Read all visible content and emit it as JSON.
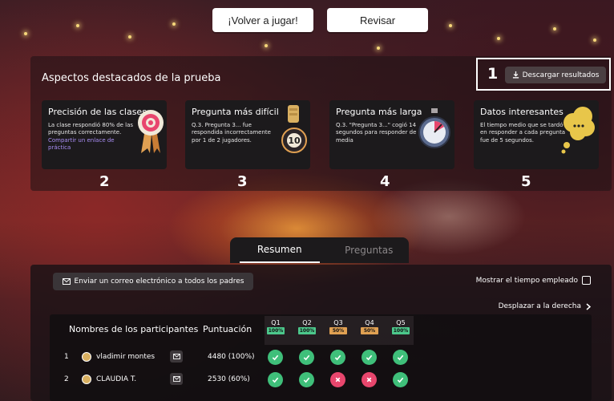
{
  "top_buttons": {
    "replay": "¡Volver a jugar!",
    "review": "Revisar"
  },
  "highlights": {
    "title": "Aspectos destacados de la prueba",
    "download_number": "1",
    "download_label": "Descargar resultados",
    "cards": [
      {
        "title": "Precisión de las clases",
        "description": "La clase respondió 80% de las preguntas correctamente.",
        "link": "Compartir un enlace de práctica",
        "number": "2",
        "icon": "target-medal-icon"
      },
      {
        "title": "Pregunta más difícil",
        "description": "Q.3. Pregunta 3... fue respondida incorrectamente por 1 de 2 jugadores.",
        "link": "",
        "number": "3",
        "icon": "hand-ball-10-icon"
      },
      {
        "title": "Pregunta más larga",
        "description": "Q.3. \"Pregunta 3...\" cogió 14 segundos para responder de media",
        "link": "",
        "number": "4",
        "icon": "stopwatch-icon"
      },
      {
        "title": "Datos interesantes",
        "description": "El tiempo medio que se tardó en responder a cada pregunta fue de 5 segundos.",
        "link": "",
        "number": "5",
        "icon": "thought-bubble-icon"
      }
    ]
  },
  "tabs": {
    "summary": "Resumen",
    "questions": "Preguntas"
  },
  "results": {
    "email_button": "Enviar un correo electrónico a todos los padres",
    "show_time_label": "Mostrar el tiempo empleado",
    "scroll_right": "Desplazar a la derecha",
    "columns": {
      "name": "Nombres de los participantes",
      "score": "Puntuación"
    },
    "questions": [
      {
        "label": "Q1",
        "pct": "100%",
        "status": "green"
      },
      {
        "label": "Q2",
        "pct": "100%",
        "status": "green"
      },
      {
        "label": "Q3",
        "pct": "50%",
        "status": "amber"
      },
      {
        "label": "Q4",
        "pct": "50%",
        "status": "amber"
      },
      {
        "label": "Q5",
        "pct": "100%",
        "status": "green"
      }
    ],
    "rows": [
      {
        "rank": "1",
        "name": "vladimir montes",
        "score": "4480 (100%)",
        "answers": [
          "correct",
          "correct",
          "correct",
          "correct",
          "correct"
        ]
      },
      {
        "rank": "2",
        "name": "CLAUDIA T.",
        "score": "2530 (60%)",
        "answers": [
          "correct",
          "correct",
          "wrong",
          "wrong",
          "correct"
        ]
      }
    ]
  },
  "colors": {
    "correct": "#3fbf7a",
    "wrong": "#e8466d",
    "link": "#a98ef5",
    "pct_green": "#4cc78b",
    "pct_amber": "#e0a052"
  }
}
